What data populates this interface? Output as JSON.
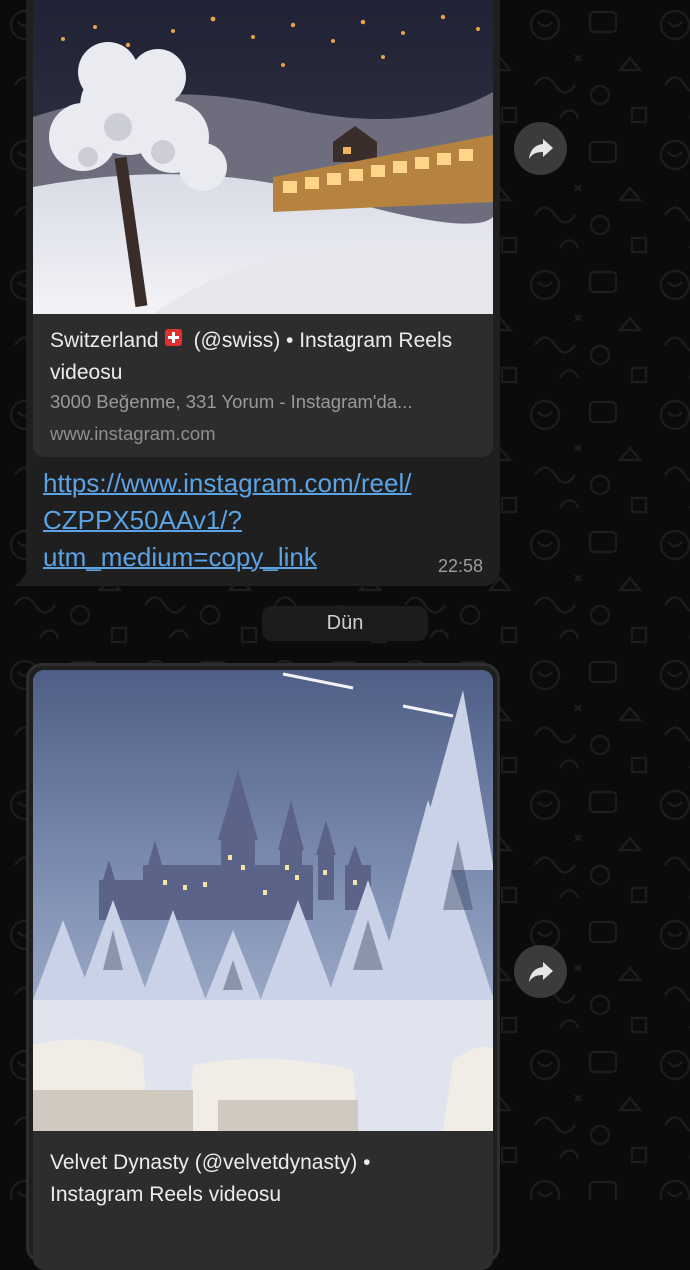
{
  "messages": [
    {
      "preview": {
        "title_part1": "Switzerland",
        "title_part2": "(@swiss) • Instagram Reels videosu",
        "flag_icon": "swiss-flag-icon",
        "description": "3000 Beğenme, 331 Yorum - Instagram'da...",
        "domain": "www.instagram.com"
      },
      "link_lines": [
        "https://www.instagram.com/reel/",
        "CZPPX50AAv1/?",
        "utm_medium=copy_link"
      ],
      "time": "22:58"
    },
    {
      "preview": {
        "title": "Velvet Dynasty (@velvetdynasty) • Instagram Reels videosu"
      }
    }
  ],
  "date_divider": "Dün",
  "colors": {
    "background": "#0b0b0b",
    "bubble": "#1f1f1f",
    "preview_card": "#2d2d2d",
    "link": "#5ba3e4",
    "forward_button": "#3b3b3b"
  },
  "icons": {
    "forward": "forward-arrow-icon"
  }
}
